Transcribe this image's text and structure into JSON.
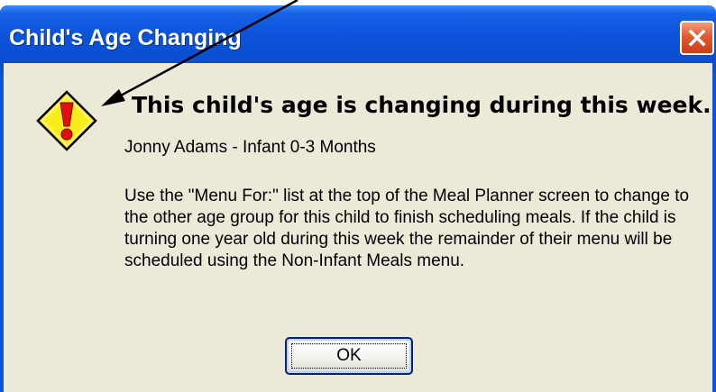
{
  "window": {
    "title": "Child's Age Changing",
    "close_icon": "close-x-icon"
  },
  "dialog": {
    "icon": "warning-icon",
    "headline": "This child's age is changing during this week.",
    "child_line": "Jonny Adams - Infant 0-3 Months",
    "message": "Use the \"Menu For:\" list at the top of the Meal Planner screen to change to the other age group for this child to finish scheduling meals. If the child is turning one year old during this week the remainder of their menu will be scheduled using the Non-Infant Meals menu.",
    "ok_label": "OK"
  },
  "annotation": {
    "icon": "pointer-arrow-icon"
  },
  "colors": {
    "titlebar": "#0b56d8",
    "dialog_bg": "#ece9d8",
    "close": "#e15a30",
    "warning_fill": "#f7ec1c",
    "warning_mark": "#e01010"
  }
}
